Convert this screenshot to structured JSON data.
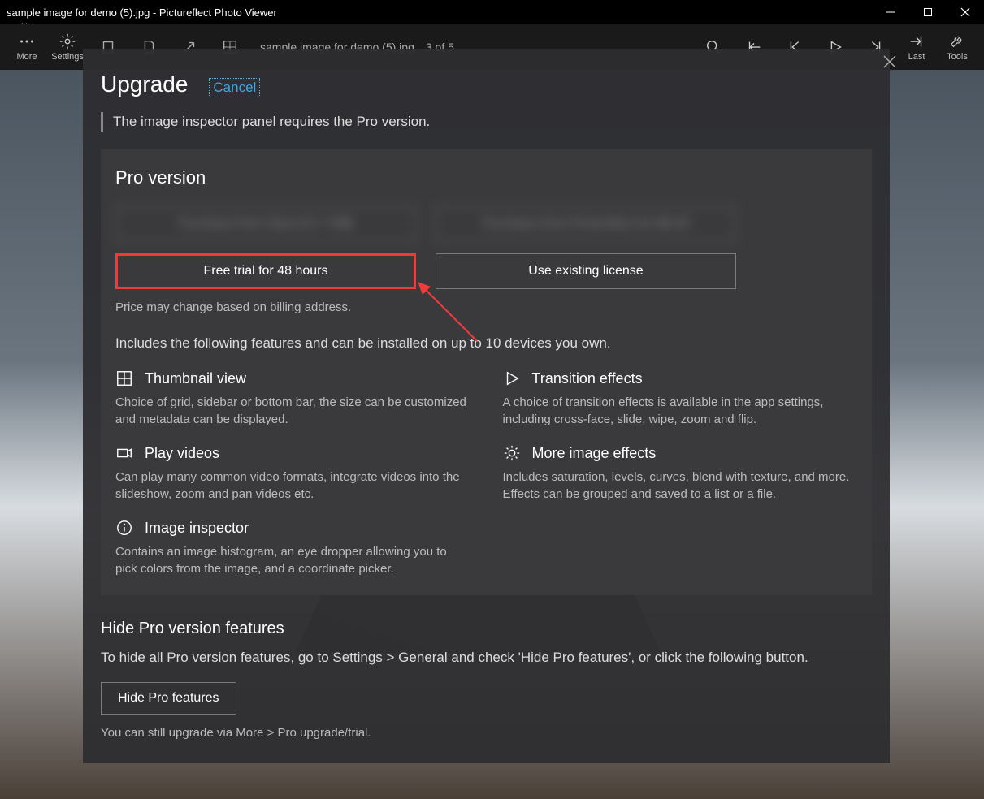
{
  "window": {
    "title": "sample image for demo (5).jpg - Pictureflect Photo Viewer"
  },
  "toolbar": {
    "more": "More",
    "settings": "Settings",
    "last": "Last",
    "tools": "Tools",
    "filename": "sample image for demo (5).jpg",
    "counter": "3 of 5"
  },
  "dialog": {
    "title": "Upgrade",
    "cancel": "Cancel",
    "prompt": "The image inspector panel requires the Pro version.",
    "pro_heading": "Pro version",
    "purchase1_blur": "Purchase from Store for 7.99$",
    "purchase2_blur": "Purchase from Pictureflect for $6.50",
    "free_trial": "Free trial for 48 hours",
    "use_license": "Use existing license",
    "price_note": "Price may change based on billing address.",
    "features_intro": "Includes the following features and can be installed on up to 10 devices you own.",
    "features": [
      {
        "title": "Thumbnail view",
        "desc": "Choice of grid, sidebar or bottom bar, the size can be customized and metadata can be displayed."
      },
      {
        "title": "Transition effects",
        "desc": "A choice of transition effects is available in the app settings, including cross-face, slide, wipe, zoom and flip."
      },
      {
        "title": "Play videos",
        "desc": "Can play many common video formats, integrate videos into the slideshow, zoom and pan videos etc."
      },
      {
        "title": "More image effects",
        "desc": "Includes saturation, levels, curves, blend with texture, and more. Effects can be grouped and saved to a list or a file."
      },
      {
        "title": "Image inspector",
        "desc": "Contains an image histogram, an eye dropper allowing you to pick colors from the image, and a coordinate picker."
      }
    ],
    "hide_heading": "Hide Pro version features",
    "hide_text": "To hide all Pro version features, go to Settings > General and check 'Hide Pro features', or click the following button.",
    "hide_button": "Hide Pro features",
    "hide_note": "You can still upgrade via More > Pro upgrade/trial."
  }
}
